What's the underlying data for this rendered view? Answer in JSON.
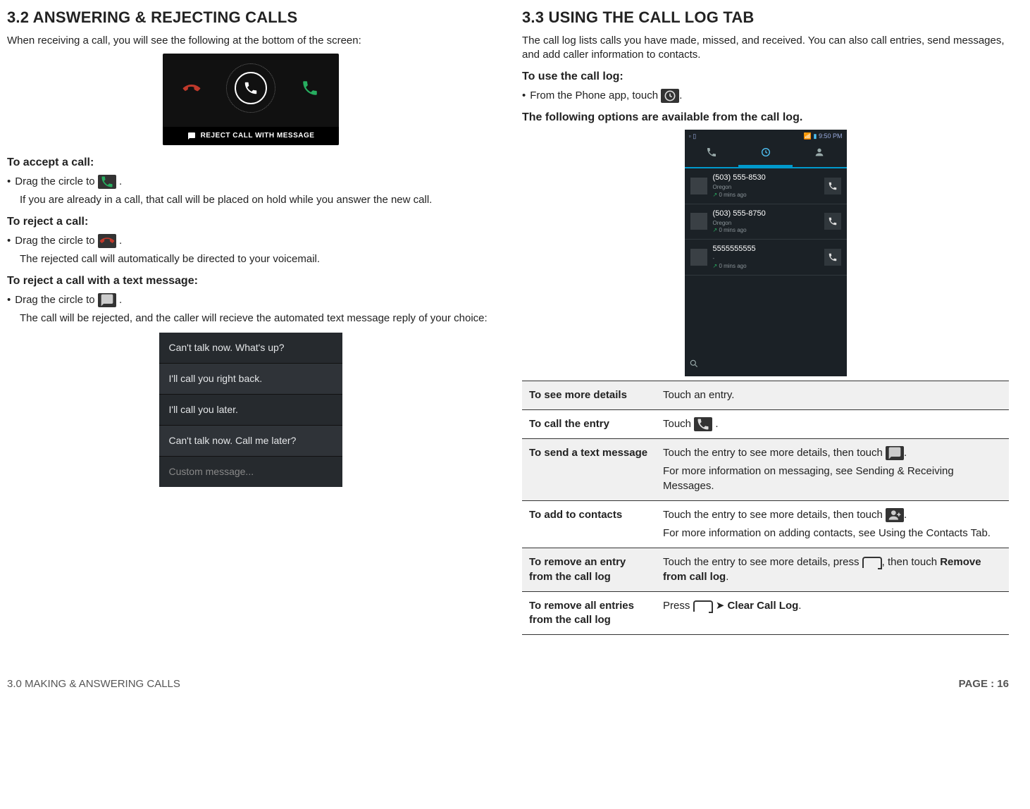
{
  "left": {
    "heading": "3.2 ANSWERING & REJECTING CALLS",
    "intro": "When receiving a call, you will see the following at the bottom of the screen:",
    "reject_bar": "REJECT CALL WITH MESSAGE",
    "accept_h": "To accept a call:",
    "accept_b1a": "Drag the circle to ",
    "accept_b1b": " .",
    "accept_note": "If you are already in a call, that call will be placed on hold while you answer the new call.",
    "reject_h": "To reject a call:",
    "reject_b1a": "Drag the circle to ",
    "reject_b1b": " .",
    "reject_note": "The rejected call will automatically be directed to your voicemail.",
    "rejtext_h": "To reject a call with a text message:",
    "rejtext_b1a": "Drag the circle to ",
    "rejtext_b1b": " .",
    "rejtext_note": "The call will be rejected, and the caller will recieve the automated text message reply of your choice:",
    "sms": [
      "Can't talk now. What's up?",
      "I'll call you right back.",
      "I'll call you later.",
      "Can't talk now. Call me later?",
      "Custom message..."
    ]
  },
  "right": {
    "heading": "3.3 USING THE CALL LOG TAB",
    "intro": "The call log lists calls you have made, missed, and received. You can also call entries, send messages, and add caller information to contacts.",
    "use_h": "To use the call log:",
    "use_b1a": "From the Phone app, touch ",
    "use_b1b": ".",
    "opts_h": "The following options are available from the call log.",
    "status_time": "9:50 PM",
    "log": [
      {
        "num": "(503) 555-8530",
        "loc": "Oregon",
        "time": "0 mins ago"
      },
      {
        "num": "(503) 555-8750",
        "loc": "Oregon",
        "time": "0 mins ago"
      },
      {
        "num": "5555555555",
        "loc": "-",
        "time": "0 mins ago"
      }
    ],
    "table": {
      "r1l": "To see more details",
      "r1v": "Touch an entry.",
      "r2l": "To call the entry",
      "r2va": "Touch ",
      "r2vb": " .",
      "r3l": "To send a text message",
      "r3va": "Touch the entry to see more details, then touch ",
      "r3vb": ".",
      "r3vc": "For more information on messaging, see Sending & Receiving Messages.",
      "r4l": "To add to contacts",
      "r4va": "Touch the entry to see more details, then touch ",
      "r4vb": ".",
      "r4vc": "For more information on adding contacts, see Using the Contacts Tab.",
      "r5l": "To remove an entry from the call log",
      "r5va": "Touch the entry to see more details, press ",
      "r5vb": ", then touch ",
      "r5vc": "Remove from call log",
      "r5vd": ".",
      "r6l": "To remove all entries from the call log",
      "r6va": "Press ",
      "r6vb": "Clear Call Log",
      "r6vc": "."
    }
  },
  "footer": {
    "left": "3.0 MAKING & ANSWERING CALLS",
    "right": "PAGE : 16"
  }
}
